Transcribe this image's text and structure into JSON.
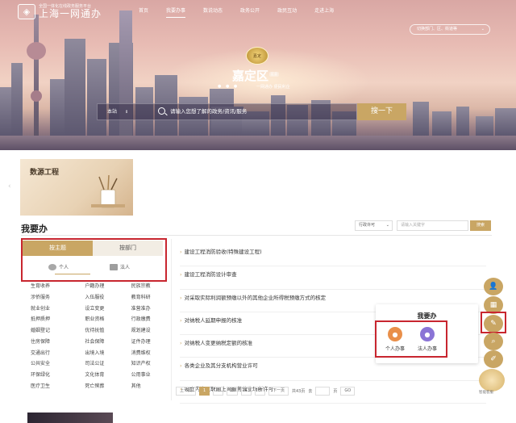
{
  "header": {
    "logo_sub": "全国一体化在线政务服务平台",
    "logo_main": "上海一网通办",
    "nav": [
      "首页",
      "我要办事",
      "数说动态",
      "政务公开",
      "政民互动",
      "走进上海"
    ],
    "active_nav": 1,
    "region_selector": "切换部门、区、街道等"
  },
  "hero": {
    "district": "嘉定区",
    "district_tag": "区县",
    "slogan": "一网通办 便民利企",
    "search_scope": "本站",
    "search_placeholder": "请输入您想了解的政务/资讯/服务",
    "search_button": "搜一下"
  },
  "banner": {
    "title": "数源工程"
  },
  "section": {
    "title": "我要办",
    "filter_value": "行政许可",
    "keyword_placeholder": "请输入关键字",
    "search_button": "搜索"
  },
  "tabs": [
    "按主题",
    "按部门"
  ],
  "subtabs": [
    "个人",
    "法人"
  ],
  "categories": [
    "生育收养",
    "户籍办理",
    "民族宗教",
    "涉侨服务",
    "入伍服役",
    "教育科研",
    "就业创业",
    "设立变更",
    "准营准办",
    "抵押质押",
    "职业资格",
    "行政缴费",
    "婚姻登记",
    "优待抚恤",
    "规划建设",
    "住房保障",
    "社会保障",
    "证件办理",
    "交通出行",
    "出境入境",
    "消费维权",
    "公共安全",
    "司法公证",
    "知识产权",
    "环保绿化",
    "文化体育",
    "公用事业",
    "医疗卫生",
    "死亡殡葬",
    "其他"
  ],
  "items": [
    "建设工程消防验收(特殊建设工程)",
    "建设工程消防设计审查",
    "对采取实际利润额预缴以外的其他企业所得税预缴方式的核定",
    "对纳税人延期申报的核准",
    "对纳税人变更纳税定额的核准",
    "各类企业及其分支机构营业许可",
    "设立内资互联网上网服务营业场所许可"
  ],
  "pager": {
    "prev": "上一页",
    "pages": [
      "1",
      "2",
      "3",
      "4",
      "5"
    ],
    "current": "1",
    "next": "下一页",
    "total": "共43页",
    "goto_prefix": "去",
    "goto_suffix": "页",
    "go": "GO"
  },
  "popup": {
    "title": "我要办",
    "options": [
      "个人办事",
      "法人办事"
    ]
  },
  "side_tools": [
    "user-icon",
    "calendar-icon",
    "handle-icon",
    "search-icon",
    "feedback-icon"
  ],
  "assistant_label": "智能客服",
  "colors": {
    "accent": "#c9a664",
    "highlight": "#c8262f"
  }
}
